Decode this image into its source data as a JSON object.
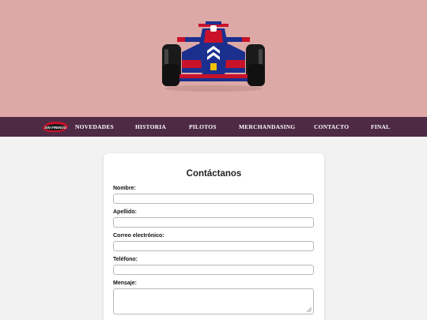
{
  "hero": {
    "image": "formula-one-car",
    "background": "#dca9a6"
  },
  "navbar": {
    "background": "#4e2a45",
    "logo": {
      "icon": "brand-logo",
      "text": "SIN FRENOS",
      "color": "#c9122a"
    },
    "items": [
      {
        "label": "NOVEDADES"
      },
      {
        "label": "HISTORIA"
      },
      {
        "label": "PILOTOS"
      },
      {
        "label": "MERCHANDASING"
      },
      {
        "label": "CONTACTO"
      },
      {
        "label": "FINAL"
      }
    ]
  },
  "contact_form": {
    "title": "Contáctanos",
    "fields": [
      {
        "label": "Nombre:",
        "value": "",
        "placeholder": ""
      },
      {
        "label": "Apellido:",
        "value": "",
        "placeholder": ""
      },
      {
        "label": "Correo electrónico:",
        "value": "",
        "placeholder": ""
      },
      {
        "label": "Teléfono:",
        "value": "",
        "placeholder": ""
      }
    ],
    "message": {
      "label": "Mensaje:",
      "value": "",
      "placeholder": ""
    }
  }
}
